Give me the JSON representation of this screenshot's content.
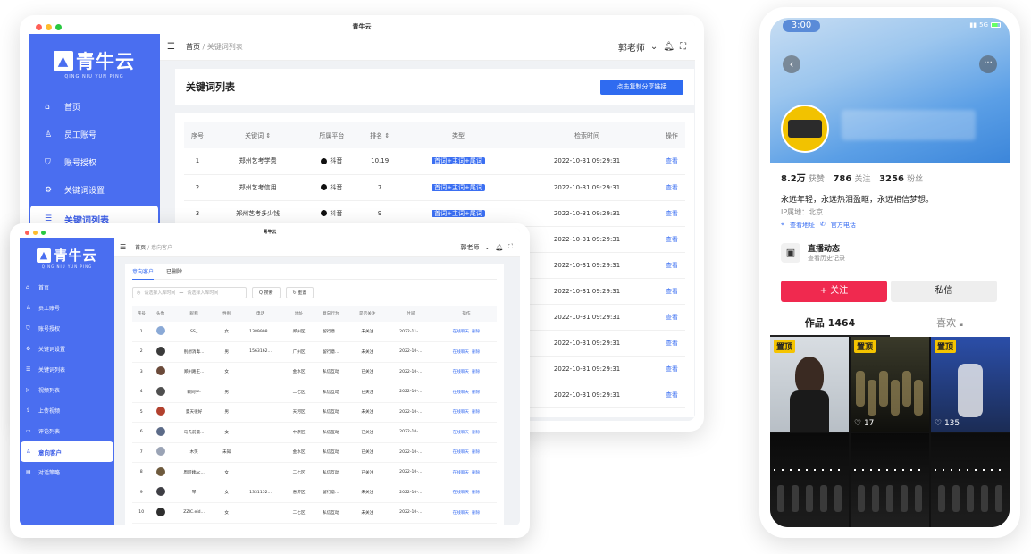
{
  "window1": {
    "title": "青牛云",
    "logo": {
      "name": "青牛云",
      "sub": "QING NIU YUN PING"
    },
    "nav": [
      {
        "icon": "home-icon",
        "glyph": "⌂",
        "label": "首页"
      },
      {
        "icon": "user-icon",
        "glyph": "♙",
        "label": "员工账号"
      },
      {
        "icon": "shield-icon",
        "glyph": "⛉",
        "label": "账号授权"
      },
      {
        "icon": "gear-icon",
        "glyph": "⚙",
        "label": "关键词设置"
      },
      {
        "icon": "list-icon",
        "glyph": "☰",
        "label": "关键词列表",
        "active": true
      }
    ],
    "breadcrumb": {
      "home": "首页",
      "sep": "/",
      "current": "关键词列表"
    },
    "user": "郭老师",
    "page_title": "关键词列表",
    "copy_button": "点击复制分享链接",
    "columns": [
      "序号",
      "关键词 ⇕",
      "所属平台",
      "排名 ⇕",
      "类型",
      "检索时间",
      "操作"
    ],
    "rows": [
      {
        "no": "1",
        "kw": "郑州艺考学费",
        "platform": "抖音",
        "rank": "10.19",
        "type": "首词+主词+尾词",
        "time": "2022-10-31 09:29:31",
        "op": "查看"
      },
      {
        "no": "2",
        "kw": "郑州艺考信用",
        "platform": "抖音",
        "rank": "7",
        "type": "首词+主词+尾词",
        "time": "2022-10-31 09:29:31",
        "op": "查看"
      },
      {
        "no": "3",
        "kw": "郑州艺考多少钱",
        "platform": "抖音",
        "rank": "9",
        "type": "首词+主词+尾词",
        "time": "2022-10-31 09:29:31",
        "op": "查看"
      },
      {
        "no": "",
        "kw": "",
        "platform": "",
        "rank": "",
        "type": "",
        "time": "2022-10-31 09:29:31",
        "op": "查看"
      },
      {
        "no": "",
        "kw": "",
        "platform": "",
        "rank": "",
        "type": "",
        "time": "2022-10-31 09:29:31",
        "op": "查看"
      },
      {
        "no": "",
        "kw": "",
        "platform": "",
        "rank": "",
        "type": "",
        "time": "2022-10-31 09:29:31",
        "op": "查看"
      },
      {
        "no": "",
        "kw": "",
        "platform": "",
        "rank": "",
        "type": "",
        "time": "2022-10-31 09:29:31",
        "op": "查看"
      },
      {
        "no": "",
        "kw": "",
        "platform": "",
        "rank": "",
        "type": "",
        "time": "2022-10-31 09:29:31",
        "op": "查看"
      },
      {
        "no": "",
        "kw": "",
        "platform": "",
        "rank": "",
        "type": "",
        "time": "2022-10-31 09:29:31",
        "op": "查看"
      },
      {
        "no": "",
        "kw": "",
        "platform": "",
        "rank": "",
        "type": "",
        "time": "2022-10-31 09:29:31",
        "op": "查看"
      }
    ]
  },
  "window2": {
    "title": "青牛云",
    "logo": {
      "name": "青牛云",
      "sub": "QING NIU YUN PING"
    },
    "nav": [
      {
        "icon": "home-icon",
        "glyph": "⌂",
        "label": "首页"
      },
      {
        "icon": "user-icon",
        "glyph": "♙",
        "label": "员工账号"
      },
      {
        "icon": "shield-icon",
        "glyph": "⛉",
        "label": "账号授权"
      },
      {
        "icon": "gear-icon",
        "glyph": "⚙",
        "label": "关键词设置"
      },
      {
        "icon": "list-icon",
        "glyph": "☰",
        "label": "关键词列表"
      },
      {
        "icon": "video-icon",
        "glyph": "▷",
        "label": "视频列表"
      },
      {
        "icon": "upload-icon",
        "glyph": "⇪",
        "label": "上传视频"
      },
      {
        "icon": "comment-icon",
        "glyph": "▭",
        "label": "评论列表"
      },
      {
        "icon": "customer-icon",
        "glyph": "♙",
        "label": "意向客户",
        "active": true
      },
      {
        "icon": "strategy-icon",
        "glyph": "▤",
        "label": "对话策略"
      }
    ],
    "breadcrumb": {
      "home": "首页",
      "sep": "/",
      "current": "意向客户"
    },
    "user": "郭老师",
    "tabs": [
      "意向客户",
      "已删除"
    ],
    "search": {
      "start": "请选择入库时间",
      "dash": "—",
      "end": "请选择入库时间",
      "search_btn": "Q 搜索",
      "reset_btn": "↻ 重置"
    },
    "columns": [
      "序号",
      "头像",
      "昵称",
      "性别",
      "电话",
      "地址",
      "意向行为",
      "是否关注",
      "时间",
      "操作"
    ],
    "rows": [
      {
        "no": "1",
        "nick": "SS_",
        "sex": "女",
        "phone": "1389998...",
        "addr": "郑州区",
        "act": "留行意...",
        "follow": "未关注",
        "time": "2022-11-...",
        "op": "在线聊天",
        "del": "删除",
        "av": "#8aa9d6"
      },
      {
        "no": "2",
        "nick": "别想消毒...",
        "sex": "男",
        "phone": "1563162...",
        "addr": "广州区",
        "act": "留行意...",
        "follow": "未关注",
        "time": "2022-10-...",
        "op": "在线聊天",
        "del": "删除",
        "av": "#3b3b3b"
      },
      {
        "no": "3",
        "nick": "郑州路王...",
        "sex": "女",
        "phone": "",
        "addr": "金水区",
        "act": "私信互动",
        "follow": "已关注",
        "time": "2022-10-...",
        "op": "在线聊天",
        "del": "删除",
        "av": "#6b4a3a"
      },
      {
        "no": "4",
        "nick": "赖同学-",
        "sex": "男",
        "phone": "",
        "addr": "二七区",
        "act": "私信互动",
        "follow": "已关注",
        "time": "2022-10-...",
        "op": "在线聊天",
        "del": "删除",
        "av": "#4f4f4f"
      },
      {
        "no": "5",
        "nick": "夏天很好",
        "sex": "男",
        "phone": "",
        "addr": "天河区",
        "act": "私信互动",
        "follow": "未关注",
        "time": "2022-10-...",
        "op": "在线聊天",
        "del": "删除",
        "av": "#b2412e"
      },
      {
        "no": "6",
        "nick": "马氏前最...",
        "sex": "女",
        "phone": "",
        "addr": "中原区",
        "act": "私信互动",
        "follow": "已关注",
        "time": "2022-10-...",
        "op": "在线聊天",
        "del": "删除",
        "av": "#5c6b88"
      },
      {
        "no": "7",
        "nick": "木笑",
        "sex": "未知",
        "phone": "",
        "addr": "金水区",
        "act": "私信互动",
        "follow": "已关注",
        "time": "2022-10-...",
        "op": "在线聊天",
        "del": "删除",
        "av": "#9aa3b5"
      },
      {
        "no": "8",
        "nick": "周阿姨ac...",
        "sex": "女",
        "phone": "",
        "addr": "二七区",
        "act": "私信互动",
        "follow": "已关注",
        "time": "2022-10-...",
        "op": "在线聊天",
        "del": "删除",
        "av": "#6e5a3d"
      },
      {
        "no": "9",
        "nick": "琴",
        "sex": "女",
        "phone": "1331152...",
        "addr": "惠济区",
        "act": "留行意...",
        "follow": "未关注",
        "time": "2022-10-...",
        "op": "在线聊天",
        "del": "删除",
        "av": "#3e3e44"
      },
      {
        "no": "10",
        "nick": "ZZIC.eid...",
        "sex": "女",
        "phone": "",
        "addr": "二七区",
        "act": "私信互动",
        "follow": "未关注",
        "time": "2022-10-...",
        "op": "在线聊天",
        "del": "删除",
        "av": "#2f2f2f"
      }
    ]
  },
  "phone": {
    "time": "3:00",
    "network": "5G",
    "stats": {
      "likes": "8.2万",
      "likes_label": "获赞",
      "following": "786",
      "following_label": "关注",
      "fans": "3256",
      "fans_label": "粉丝"
    },
    "bio": "永远年轻，永远热泪盈眶，永远相信梦想。",
    "ip": "IP属地：北京",
    "chips": [
      "查看地址",
      "官方电话"
    ],
    "live": {
      "title": "直播动态",
      "sub": "查看历史记录"
    },
    "follow_btn": "+ 关注",
    "message_btn": "私信",
    "tabs": {
      "works": "作品 1464",
      "likes": "喜欢"
    },
    "videos": [
      {
        "pin": "置顶",
        "likes": "",
        "bg": "linear-gradient(180deg,#d8dde2,#b8bfc6)"
      },
      {
        "pin": "置顶",
        "likes": "17",
        "bg": "linear-gradient(180deg,#3a3a2a,#0f0f0c)"
      },
      {
        "pin": "置顶",
        "likes": "135",
        "bg": "linear-gradient(180deg,#2b4ea8,#1b2c55)"
      },
      {
        "pin": "",
        "likes": "",
        "bg": "linear-gradient(180deg,#0a0a0a,#1d1d1d)"
      },
      {
        "pin": "",
        "likes": "",
        "bg": "linear-gradient(180deg,#090909,#202020)"
      },
      {
        "pin": "",
        "likes": "",
        "bg": "linear-gradient(180deg,#0c0c0c,#1e1e1e)"
      }
    ]
  }
}
